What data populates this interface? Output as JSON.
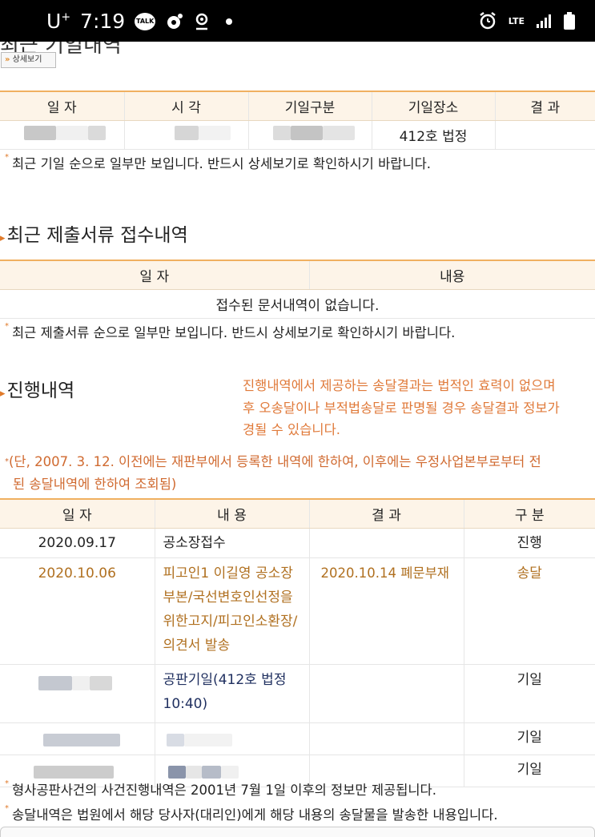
{
  "status_bar": {
    "carrier": "U",
    "carrier_sup": "+",
    "time": "7:19",
    "talk_label": "TALK",
    "network": "LTE"
  },
  "hearing": {
    "title": "최근 기일내역",
    "detail_button": "상세보기",
    "detail_arrow": "»",
    "headers": [
      "일 자",
      "시 각",
      "기일구분",
      "기일장소",
      "결 과"
    ],
    "row": {
      "place": "412호 법정"
    },
    "note": "최근 기일 순으로 일부만 보입니다. 반드시 상세보기로 확인하시기 바랍니다."
  },
  "documents": {
    "title": "최근 제출서류 접수내역",
    "headers": [
      "일 자",
      "내용"
    ],
    "empty": "접수된 문서내역이 없습니다.",
    "note": "최근 제출서류 순으로 일부만 보입니다. 반드시 상세보기로 확인하시기 바랍니다."
  },
  "progress": {
    "title": "진행내역",
    "warning_lines": [
      "진행내역에서 제공하는 송달결과는 법적인 효력이 없으며",
      "후 오송달이나 부적법송달로 판명될 경우 송달결과 정보가",
      "경될 수 있습니다."
    ],
    "sub_note_lines": [
      "(단, 2007. 3. 12. 이전에는 재판부에서 등록한 내역에 한하여, 이후에는 우정사업본부로부터 전",
      "된 송달내역에 한하여 조회됨)"
    ],
    "headers": [
      "일 자",
      "내 용",
      "결 과",
      "구 분"
    ],
    "rows": [
      {
        "date": "2020.09.17",
        "content": "공소장접수",
        "result": "",
        "type": "진행"
      },
      {
        "date": "2020.10.06",
        "content": "피고인1 이길영 공소장부본/국선변호인선정을위한고지/피고인소환장/의견서 발송",
        "result": "2020.10.14 폐문부재",
        "type": "송달"
      },
      {
        "date": "",
        "content": "공판기일(412호 법정 10:40)",
        "result": "",
        "type": "기일"
      },
      {
        "date": "",
        "content": "",
        "result": "",
        "type": "기일"
      },
      {
        "date": "",
        "content": "",
        "result": "",
        "type": "기일"
      }
    ],
    "footnotes": [
      "형사공판사건의 사건진행내역은 2001년 7월 1일 이후의 정보만 제공됩니다.",
      "송달내역은 법원에서 해당 당사자(대리인)에게 해당 내용의 송달물을 발송한 내용입니다."
    ]
  },
  "colors": {
    "accent_orange": "#e07a2a",
    "header_bg": "#fdf4e8",
    "brown_text": "#b07020",
    "navy_text": "#203060"
  }
}
